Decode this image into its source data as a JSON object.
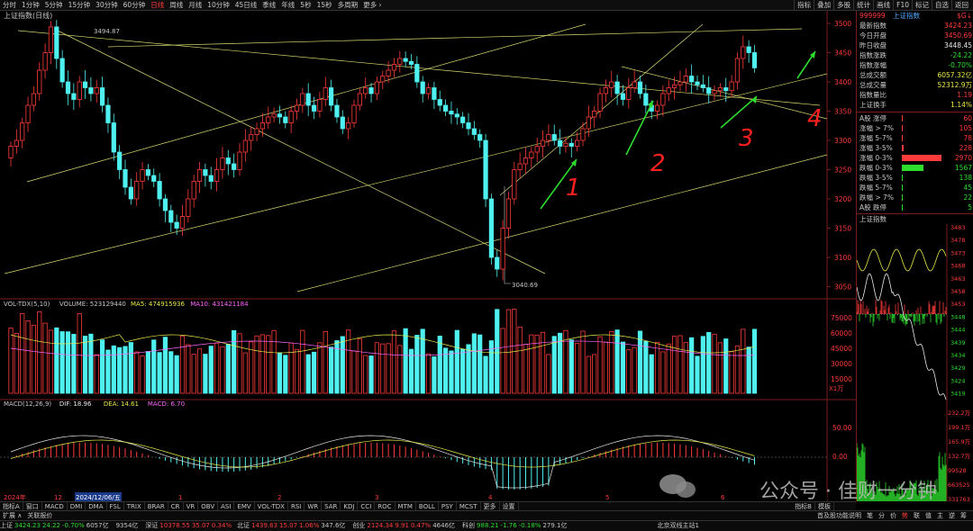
{
  "toolbar": {
    "periods": [
      "分时",
      "1分钟",
      "5分钟",
      "15分钟",
      "30分钟",
      "60分钟",
      "日线",
      "周线",
      "月线",
      "10分钟",
      "45日线",
      "季线",
      "年线",
      "5秒",
      "15秒",
      "多周期",
      "更多 ›"
    ],
    "active_index": 6,
    "right_tools": [
      "指标",
      "叠加",
      "多股",
      "统计",
      "画线",
      "F10",
      "标记",
      "自选",
      "返回"
    ]
  },
  "chart": {
    "title": "上证指数(日线)",
    "high_marker": "3494.87",
    "low_marker": "3040.69",
    "price_axis": [
      "3500",
      "3450",
      "3400",
      "3350",
      "3300",
      "3250",
      "3200",
      "3150",
      "3100",
      "3050"
    ],
    "volume_axis": [
      "75000",
      "60000",
      "45000",
      "30000",
      "15000"
    ],
    "volume_unit": "X1万",
    "macd_axis": [
      "50.00",
      "0.00"
    ],
    "annotations": [
      "1",
      "2",
      "3",
      "4"
    ],
    "x_labels": [
      "2024年",
      "12",
      "2024/12/06/五",
      "1",
      "2",
      "3",
      "4",
      "5",
      "6"
    ],
    "vol_header": {
      "name": "VOL-TDX(5,10)",
      "volume": "VOLUME: 523129440",
      "ma5": "MA5: 474915936",
      "ma10": "MA10: 431421184"
    },
    "macd_header": {
      "name": "MACD(12,26,9)",
      "dif": "DIF: 18.96",
      "dea": "DEA: 14.61",
      "macd": "MACD: 6.70"
    }
  },
  "quote": {
    "code": "999999",
    "name": "上证指数",
    "badge": "$G↓",
    "rows": [
      {
        "label": "最新指数",
        "value": "3424.23",
        "color": "red"
      },
      {
        "label": "今日开盘",
        "value": "3450.69",
        "color": "red"
      },
      {
        "label": "昨日收盘",
        "value": "3448.45",
        "color": "white"
      },
      {
        "label": "指数涨跌",
        "value": "-24.22",
        "color": "green"
      },
      {
        "label": "指数涨幅",
        "value": "-0.70%",
        "color": "green"
      },
      {
        "label": "总成交额",
        "value": "6057.32亿",
        "color": "yel"
      },
      {
        "label": "总成交量",
        "value": "52312.9万",
        "color": "yel"
      },
      {
        "label": "指数量比",
        "value": "1.19",
        "color": "red"
      },
      {
        "label": "上证换手",
        "value": "1.14%",
        "color": "yel"
      }
    ],
    "breadth": [
      {
        "label": "A股 涨停",
        "value": "60",
        "color": "red",
        "bar": 0.01
      },
      {
        "label": "涨幅 > 7%",
        "value": "105",
        "color": "red",
        "bar": 0.02
      },
      {
        "label": "涨幅 5-7%",
        "value": "78",
        "color": "red",
        "bar": 0.015
      },
      {
        "label": "涨幅 3-5%",
        "value": "228",
        "color": "red",
        "bar": 0.04
      },
      {
        "label": "涨幅 0-3%",
        "value": "2970",
        "color": "red",
        "bar": 0.92
      },
      {
        "label": "跌幅 0-3%",
        "value": "1567",
        "color": "green",
        "bar": 0.5
      },
      {
        "label": "跌幅 3-5%",
        "value": "138",
        "color": "green",
        "bar": 0.03
      },
      {
        "label": "跌幅 5-7%",
        "value": "45",
        "color": "green",
        "bar": 0.01
      },
      {
        "label": "跌幅 > 7%",
        "value": "22",
        "color": "green",
        "bar": 0.008
      },
      {
        "label": "A股 跌停",
        "value": "5",
        "color": "green",
        "bar": 0.004
      }
    ],
    "mini_title": "上证指数",
    "mini_price_axis": [
      "3483",
      "3478",
      "3473",
      "3468",
      "3463",
      "3458",
      "3453",
      "3448",
      "3444",
      "3439",
      "3434",
      "3429",
      "3424",
      "3419"
    ],
    "mini_vol_axis": [
      "232.2万",
      "199.1万",
      "165.9万",
      "132.7万",
      "99528",
      "663525",
      "331763"
    ]
  },
  "indicator_tabs": [
    "指标A",
    "窗口",
    "MACD",
    "DMI",
    "DMA",
    "FSL",
    "TRIX",
    "BRAR",
    "CR",
    "VR",
    "OBV",
    "ASI",
    "EMV",
    "VOL-TDX",
    "RSI",
    "WR",
    "SAR",
    "KDJ",
    "CCI",
    "ROC",
    "MTM",
    "BOLL",
    "PSY",
    "MCST",
    "更多",
    "设置"
  ],
  "indicator_right": [
    "指标B",
    "模板"
  ],
  "ext_tabs": [
    "扩展 ∧",
    "关联报价"
  ],
  "ext_right": "首及股功能说明",
  "ext_right_tabs": [
    "笔",
    "分",
    "价",
    "势",
    "联",
    "值",
    "主",
    "逆",
    "筹"
  ],
  "status": [
    {
      "name": "上证",
      "value": "3424.23",
      "chg": "24.22",
      "pct": "-0.70%",
      "amt": "6057亿"
    },
    {
      "name": "",
      "value": "",
      "chg": "",
      "pct": "",
      "amt": "9354亿"
    },
    {
      "name": "深证",
      "value": "10378.55",
      "chg": "35.07",
      "pct": "0.34%",
      "amt": ""
    },
    {
      "name": "北证",
      "value": "1439.63",
      "chg": "15.07",
      "pct": "1.06%",
      "amt": "347.6亿"
    },
    {
      "name": "创业",
      "value": "2124.34",
      "chg": "9.91",
      "pct": "0.47%",
      "amt": "4646亿"
    },
    {
      "name": "科创",
      "value": "988.21",
      "chg": "-1.76",
      "pct": "-0.18%",
      "amt": "279.1亿"
    }
  ],
  "status_right": "北京双线主站1",
  "watermark": "公众号 · 佳财一分钟"
}
